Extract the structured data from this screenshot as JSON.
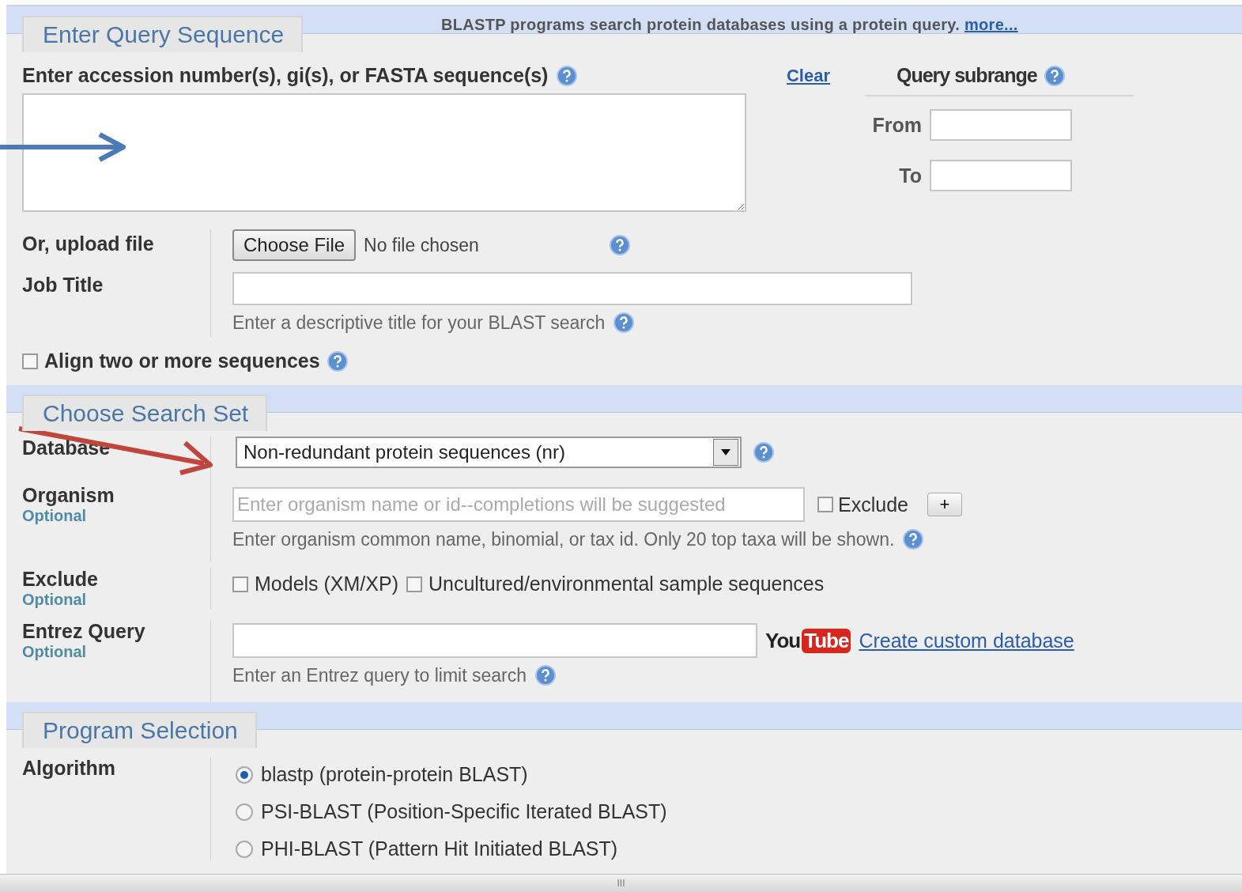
{
  "query_section": {
    "title": "Enter Query Sequence",
    "notice": "BLASTP programs search protein databases using a protein query.",
    "notice_link": "more...",
    "sequence_label": "Enter accession number(s), gi(s), or FASTA sequence(s)",
    "clear_link": "Clear",
    "subrange_title": "Query subrange",
    "from_label": "From",
    "to_label": "To",
    "upload_label": "Or, upload file",
    "upload_button": "Choose File",
    "upload_status": "No file chosen",
    "job_title_label": "Job Title",
    "job_title_hint": "Enter a descriptive title for your BLAST search",
    "align": {
      "label": "Align two or more sequences",
      "checked": false
    }
  },
  "search_set_section": {
    "title": "Choose Search Set",
    "database_label": "Database",
    "database_value": "Non-redundant protein sequences (nr)",
    "organism_label": "Organism",
    "organism_optional": "Optional",
    "organism_placeholder": "Enter organism name or id--completions will be suggested",
    "organism_exclude": {
      "label": "Exclude",
      "checked": false
    },
    "add_button": "+",
    "organism_hint": "Enter organism common name, binomial, or tax id. Only 20 top taxa will be shown.",
    "exclude_label": "Exclude",
    "exclude_optional": "Optional",
    "exclude_options": [
      {
        "label": "Models (XM/XP)",
        "checked": false
      },
      {
        "label": "Uncultured/environmental sample sequences",
        "checked": false
      }
    ],
    "entrez_label": "Entrez Query",
    "entrez_optional": "Optional",
    "video_logo": [
      "You",
      "Tube"
    ],
    "custom_db_link": "Create custom database",
    "entrez_hint": "Enter an Entrez query to limit search"
  },
  "program_section": {
    "title": "Program Selection",
    "algorithm_label": "Algorithm",
    "algorithms": [
      {
        "label": "blastp (protein-protein BLAST)",
        "selected": true
      },
      {
        "label": "PSI-BLAST (Position-Specific Iterated BLAST)",
        "selected": false
      },
      {
        "label": "PHI-BLAST (Pattern Hit Initiated BLAST)",
        "selected": false
      }
    ]
  },
  "scrollbar_grip": "III"
}
